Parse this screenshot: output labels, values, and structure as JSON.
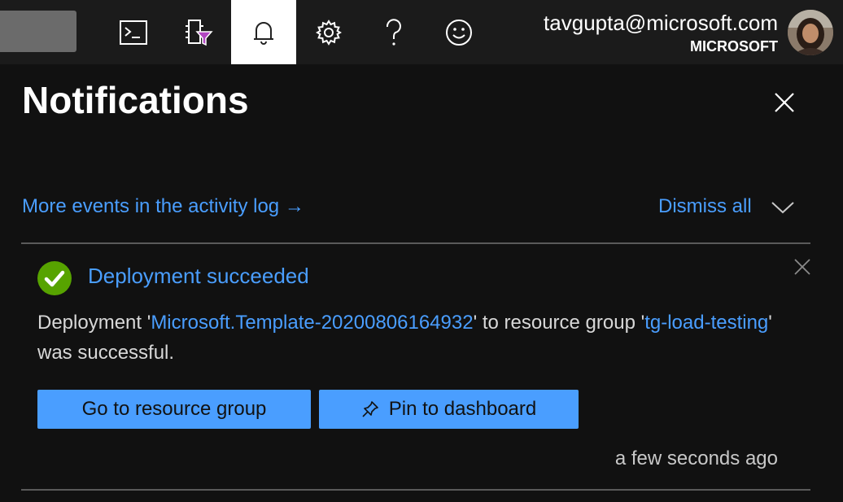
{
  "topbar": {
    "icons": [
      "cloud-shell-icon",
      "directory-filter-icon",
      "notifications-bell-icon",
      "settings-gear-icon",
      "help-icon",
      "feedback-smiley-icon"
    ],
    "account": {
      "email": "tavgupta@microsoft.com",
      "tenant": "MICROSOFT"
    }
  },
  "panel": {
    "title": "Notifications",
    "activity_link": "More events in the activity log →",
    "dismiss_all": "Dismiss all"
  },
  "notification": {
    "status": "success",
    "title": "Deployment succeeded",
    "body": {
      "prefix": "Deployment '",
      "deployment_name": "Microsoft.Template-20200806164932",
      "middle": "' to resource group '",
      "resource_group": "tg-load-testing",
      "suffix": "' was successful."
    },
    "go_button": "Go to resource group",
    "pin_button": "Pin to dashboard",
    "timestamp": "a few seconds ago"
  },
  "colors": {
    "background": "#111111",
    "topbar": "#1b1b1b",
    "accent": "#4a9eff",
    "success": "#57a300"
  }
}
